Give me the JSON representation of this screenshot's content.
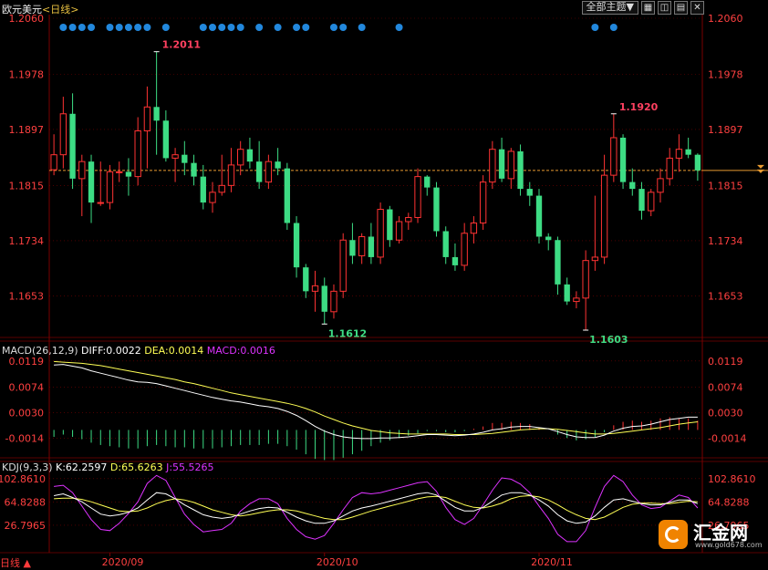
{
  "header": {
    "symbol": "欧元美元",
    "period": "<日线>",
    "theme_button": "全部主题▼",
    "window_icons": [
      "grid-icon",
      "layout-icon",
      "chart-icon",
      "close-icon"
    ]
  },
  "colors": {
    "up": "#ff3333",
    "down": "#3ddc84",
    "price_label": "#ff4040",
    "grid": "#7a0000",
    "dif": "#ffffff",
    "dea": "#ffff55",
    "macd": "#dd33ff",
    "k": "#ffffff",
    "d": "#ffff55",
    "j": "#dd33ff",
    "dots": "#2288dd"
  },
  "chart_data": [
    {
      "type": "candlestick",
      "title": "欧元美元<日线>",
      "y_ticks": [
        "1.2060",
        "1.1978",
        "1.1897",
        "1.1815",
        "1.1734",
        "1.1653"
      ],
      "y_tick_values": [
        1.206,
        1.1978,
        1.1897,
        1.1815,
        1.1734,
        1.1653
      ],
      "ylim": [
        1.1595,
        1.206
      ],
      "x_ticks": [
        "2020/09",
        "2020/10",
        "2020/11"
      ],
      "current_price": 1.1837,
      "annotations": [
        {
          "label": "1.2011",
          "kind": "high",
          "index": 11
        },
        {
          "label": "1.1612",
          "kind": "low",
          "index": 29
        },
        {
          "label": "1.1920",
          "kind": "high",
          "index": 60
        },
        {
          "label": "1.1603",
          "kind": "low",
          "index": 57
        }
      ],
      "signal_dot_indices": [
        1,
        2,
        3,
        4,
        6,
        7,
        8,
        9,
        10,
        12,
        16,
        17,
        18,
        19,
        20,
        22,
        24,
        26,
        27,
        30,
        31,
        33,
        37,
        58,
        60
      ],
      "candles": [
        {
          "o": 1.1838,
          "h": 1.189,
          "l": 1.183,
          "c": 1.186
        },
        {
          "o": 1.186,
          "h": 1.1945,
          "l": 1.184,
          "c": 1.192
        },
        {
          "o": 1.192,
          "h": 1.195,
          "l": 1.181,
          "c": 1.1825
        },
        {
          "o": 1.1825,
          "h": 1.186,
          "l": 1.177,
          "c": 1.185
        },
        {
          "o": 1.185,
          "h": 1.186,
          "l": 1.176,
          "c": 1.179
        },
        {
          "o": 1.179,
          "h": 1.185,
          "l": 1.1785,
          "c": 1.179
        },
        {
          "o": 1.179,
          "h": 1.1845,
          "l": 1.178,
          "c": 1.1835
        },
        {
          "o": 1.1835,
          "h": 1.185,
          "l": 1.182,
          "c": 1.1835
        },
        {
          "o": 1.1835,
          "h": 1.1855,
          "l": 1.18,
          "c": 1.1828
        },
        {
          "o": 1.1828,
          "h": 1.1915,
          "l": 1.1815,
          "c": 1.1895
        },
        {
          "o": 1.1895,
          "h": 1.196,
          "l": 1.184,
          "c": 1.193
        },
        {
          "o": 1.193,
          "h": 1.2011,
          "l": 1.186,
          "c": 1.191
        },
        {
          "o": 1.191,
          "h": 1.1925,
          "l": 1.185,
          "c": 1.1855
        },
        {
          "o": 1.1855,
          "h": 1.187,
          "l": 1.182,
          "c": 1.186
        },
        {
          "o": 1.186,
          "h": 1.188,
          "l": 1.183,
          "c": 1.1848
        },
        {
          "o": 1.1848,
          "h": 1.186,
          "l": 1.1815,
          "c": 1.1828
        },
        {
          "o": 1.1828,
          "h": 1.1845,
          "l": 1.178,
          "c": 1.179
        },
        {
          "o": 1.179,
          "h": 1.182,
          "l": 1.1775,
          "c": 1.1805
        },
        {
          "o": 1.1805,
          "h": 1.186,
          "l": 1.18,
          "c": 1.1815
        },
        {
          "o": 1.1815,
          "h": 1.187,
          "l": 1.1805,
          "c": 1.1845
        },
        {
          "o": 1.1845,
          "h": 1.188,
          "l": 1.183,
          "c": 1.1868
        },
        {
          "o": 1.1868,
          "h": 1.1885,
          "l": 1.184,
          "c": 1.185
        },
        {
          "o": 1.185,
          "h": 1.188,
          "l": 1.181,
          "c": 1.182
        },
        {
          "o": 1.182,
          "h": 1.186,
          "l": 1.181,
          "c": 1.185
        },
        {
          "o": 1.185,
          "h": 1.187,
          "l": 1.183,
          "c": 1.184
        },
        {
          "o": 1.184,
          "h": 1.1848,
          "l": 1.175,
          "c": 1.176
        },
        {
          "o": 1.176,
          "h": 1.177,
          "l": 1.168,
          "c": 1.1695
        },
        {
          "o": 1.1695,
          "h": 1.17,
          "l": 1.165,
          "c": 1.166
        },
        {
          "o": 1.166,
          "h": 1.169,
          "l": 1.163,
          "c": 1.1668
        },
        {
          "o": 1.1668,
          "h": 1.168,
          "l": 1.1612,
          "c": 1.163
        },
        {
          "o": 1.163,
          "h": 1.167,
          "l": 1.162,
          "c": 1.166
        },
        {
          "o": 1.166,
          "h": 1.1745,
          "l": 1.165,
          "c": 1.1735
        },
        {
          "o": 1.1735,
          "h": 1.176,
          "l": 1.17,
          "c": 1.1712
        },
        {
          "o": 1.1712,
          "h": 1.1745,
          "l": 1.17,
          "c": 1.174
        },
        {
          "o": 1.174,
          "h": 1.176,
          "l": 1.17,
          "c": 1.171
        },
        {
          "o": 1.171,
          "h": 1.179,
          "l": 1.17,
          "c": 1.178
        },
        {
          "o": 1.178,
          "h": 1.1785,
          "l": 1.1725,
          "c": 1.1735
        },
        {
          "o": 1.1735,
          "h": 1.177,
          "l": 1.173,
          "c": 1.1762
        },
        {
          "o": 1.1762,
          "h": 1.1775,
          "l": 1.175,
          "c": 1.1768
        },
        {
          "o": 1.1768,
          "h": 1.184,
          "l": 1.176,
          "c": 1.1828
        },
        {
          "o": 1.1828,
          "h": 1.183,
          "l": 1.18,
          "c": 1.1812
        },
        {
          "o": 1.1812,
          "h": 1.182,
          "l": 1.174,
          "c": 1.1748
        },
        {
          "o": 1.1748,
          "h": 1.1755,
          "l": 1.17,
          "c": 1.171
        },
        {
          "o": 1.171,
          "h": 1.173,
          "l": 1.169,
          "c": 1.1698
        },
        {
          "o": 1.1698,
          "h": 1.176,
          "l": 1.169,
          "c": 1.1745
        },
        {
          "o": 1.1745,
          "h": 1.177,
          "l": 1.173,
          "c": 1.176
        },
        {
          "o": 1.176,
          "h": 1.183,
          "l": 1.175,
          "c": 1.182
        },
        {
          "o": 1.182,
          "h": 1.188,
          "l": 1.181,
          "c": 1.1868
        },
        {
          "o": 1.1868,
          "h": 1.1885,
          "l": 1.182,
          "c": 1.1825
        },
        {
          "o": 1.1825,
          "h": 1.187,
          "l": 1.181,
          "c": 1.1865
        },
        {
          "o": 1.1865,
          "h": 1.1875,
          "l": 1.18,
          "c": 1.181
        },
        {
          "o": 1.181,
          "h": 1.182,
          "l": 1.1785,
          "c": 1.18
        },
        {
          "o": 1.18,
          "h": 1.181,
          "l": 1.173,
          "c": 1.174
        },
        {
          "o": 1.174,
          "h": 1.1745,
          "l": 1.172,
          "c": 1.1735
        },
        {
          "o": 1.1735,
          "h": 1.174,
          "l": 1.1655,
          "c": 1.167
        },
        {
          "o": 1.167,
          "h": 1.168,
          "l": 1.164,
          "c": 1.1645
        },
        {
          "o": 1.1645,
          "h": 1.166,
          "l": 1.1635,
          "c": 1.165
        },
        {
          "o": 1.165,
          "h": 1.172,
          "l": 1.1603,
          "c": 1.1705
        },
        {
          "o": 1.1705,
          "h": 1.18,
          "l": 1.169,
          "c": 1.171
        },
        {
          "o": 1.171,
          "h": 1.186,
          "l": 1.17,
          "c": 1.183
        },
        {
          "o": 1.183,
          "h": 1.192,
          "l": 1.182,
          "c": 1.1885
        },
        {
          "o": 1.1885,
          "h": 1.189,
          "l": 1.181,
          "c": 1.182
        },
        {
          "o": 1.182,
          "h": 1.184,
          "l": 1.18,
          "c": 1.181
        },
        {
          "o": 1.181,
          "h": 1.182,
          "l": 1.1765,
          "c": 1.1778
        },
        {
          "o": 1.1778,
          "h": 1.181,
          "l": 1.177,
          "c": 1.1805
        },
        {
          "o": 1.1805,
          "h": 1.184,
          "l": 1.179,
          "c": 1.1825
        },
        {
          "o": 1.1825,
          "h": 1.187,
          "l": 1.1815,
          "c": 1.1855
        },
        {
          "o": 1.1855,
          "h": 1.189,
          "l": 1.1835,
          "c": 1.1868
        },
        {
          "o": 1.1868,
          "h": 1.1885,
          "l": 1.1855,
          "c": 1.186
        },
        {
          "o": 1.186,
          "h": 1.1862,
          "l": 1.1822,
          "c": 1.1837
        }
      ]
    },
    {
      "type": "line",
      "title": "MACD(26,12,9)",
      "labels": {
        "dif": "DIFF:0.0022",
        "dea": "DEA:0.0014",
        "macd": "MACD:0.0016"
      },
      "y_ticks": [
        "0.0119",
        "0.0074",
        "0.0030",
        "-0.0014"
      ],
      "y_tick_values": [
        0.0119,
        0.0074,
        0.003,
        -0.0014
      ],
      "ylim": [
        -0.0045,
        0.0125
      ],
      "series": [
        {
          "key": "dif",
          "values": [
            0.0112,
            0.0113,
            0.011,
            0.0107,
            0.0102,
            0.0098,
            0.0094,
            0.009,
            0.0086,
            0.0083,
            0.0082,
            0.008,
            0.0076,
            0.0072,
            0.0068,
            0.0064,
            0.006,
            0.0056,
            0.0053,
            0.005,
            0.0048,
            0.0045,
            0.0042,
            0.004,
            0.0037,
            0.0032,
            0.0025,
            0.0016,
            0.0006,
            -0.0002,
            -0.0008,
            -0.0012,
            -0.0014,
            -0.0015,
            -0.0015,
            -0.0014,
            -0.0014,
            -0.0013,
            -0.0012,
            -0.001,
            -0.0008,
            -0.0008,
            -0.0009,
            -0.001,
            -0.0009,
            -0.0007,
            -0.0004,
            0.0,
            0.0002,
            0.0005,
            0.0006,
            0.0006,
            0.0004,
            0.0002,
            -0.0003,
            -0.0008,
            -0.0012,
            -0.0013,
            -0.0013,
            -0.0009,
            -0.0002,
            0.0003,
            0.0006,
            0.0007,
            0.001,
            0.0014,
            0.0018,
            0.002,
            0.0022,
            0.0022
          ]
        },
        {
          "key": "dea",
          "values": [
            0.0118,
            0.0117,
            0.0116,
            0.0115,
            0.0113,
            0.0111,
            0.0108,
            0.0105,
            0.0102,
            0.0099,
            0.0096,
            0.0093,
            0.009,
            0.0087,
            0.0083,
            0.008,
            0.0076,
            0.0072,
            0.0068,
            0.0064,
            0.0061,
            0.0058,
            0.0055,
            0.0052,
            0.0049,
            0.0046,
            0.0042,
            0.0037,
            0.0031,
            0.0024,
            0.0018,
            0.0012,
            0.0007,
            0.0003,
            -0.0001,
            -0.0003,
            -0.0005,
            -0.0006,
            -0.0007,
            -0.0007,
            -0.0007,
            -0.0007,
            -0.0007,
            -0.0008,
            -0.0008,
            -0.0008,
            -0.0007,
            -0.0006,
            -0.0004,
            -0.0002,
            0.0,
            0.0001,
            0.0002,
            0.0002,
            0.0001,
            -0.0001,
            -0.0003,
            -0.0005,
            -0.0007,
            -0.0007,
            -0.0006,
            -0.0004,
            -0.0002,
            0.0,
            0.0002,
            0.0004,
            0.0007,
            0.001,
            0.0012,
            0.0014
          ]
        },
        {
          "key": "macd",
          "values": [
            -0.0012,
            -0.0008,
            -0.0012,
            -0.0016,
            -0.0022,
            -0.0026,
            -0.0028,
            -0.003,
            -0.0032,
            -0.0032,
            -0.0028,
            -0.0026,
            -0.0028,
            -0.003,
            -0.003,
            -0.0032,
            -0.0032,
            -0.0032,
            -0.003,
            -0.0028,
            -0.0026,
            -0.0026,
            -0.0026,
            -0.0024,
            -0.0024,
            -0.0028,
            -0.0034,
            -0.0042,
            -0.005,
            -0.0052,
            -0.0052,
            -0.0048,
            -0.0042,
            -0.0036,
            -0.0028,
            -0.0022,
            -0.0018,
            -0.0014,
            -0.001,
            -0.0006,
            -0.0002,
            -0.0002,
            -0.0004,
            -0.0004,
            -0.0002,
            0.0002,
            0.0006,
            0.0012,
            0.0012,
            0.0014,
            0.0012,
            0.001,
            0.0004,
            0.0,
            -0.0008,
            -0.0014,
            -0.0018,
            -0.0016,
            -0.0012,
            -0.0004,
            0.0008,
            0.0014,
            0.0016,
            0.0014,
            0.0016,
            0.002,
            0.0022,
            0.002,
            0.002,
            0.0016
          ]
        }
      ]
    },
    {
      "type": "line",
      "title": "KDJ(9,3,3)",
      "labels": {
        "k": "K:62.2597",
        "d": "D:65.6263",
        "j": "J:55.5265"
      },
      "y_ticks": [
        "102.8610",
        "64.8288",
        "26.7965"
      ],
      "y_tick_values": [
        102.861,
        64.8288,
        26.7965
      ],
      "ylim": [
        -15,
        110
      ],
      "series": [
        {
          "key": "k",
          "values": [
            75,
            78,
            72,
            65,
            55,
            45,
            42,
            44,
            48,
            55,
            68,
            80,
            78,
            70,
            60,
            52,
            44,
            40,
            38,
            40,
            45,
            50,
            54,
            56,
            55,
            48,
            40,
            34,
            30,
            30,
            34,
            42,
            50,
            55,
            58,
            62,
            66,
            70,
            74,
            78,
            80,
            76,
            66,
            56,
            50,
            50,
            56,
            66,
            76,
            80,
            80,
            76,
            68,
            58,
            44,
            34,
            30,
            32,
            42,
            56,
            68,
            70,
            66,
            62,
            60,
            60,
            64,
            68,
            68,
            62
          ]
        },
        {
          "key": "d",
          "values": [
            70,
            71,
            71,
            69,
            65,
            60,
            55,
            50,
            49,
            50,
            55,
            62,
            67,
            70,
            68,
            64,
            58,
            52,
            48,
            44,
            42,
            44,
            47,
            50,
            52,
            52,
            50,
            46,
            42,
            38,
            36,
            36,
            40,
            45,
            50,
            54,
            58,
            62,
            66,
            70,
            73,
            74,
            72,
            66,
            60,
            56,
            55,
            58,
            63,
            70,
            74,
            75,
            73,
            68,
            60,
            51,
            44,
            38,
            36,
            40,
            48,
            56,
            61,
            63,
            63,
            62,
            62,
            64,
            66,
            65
          ]
        },
        {
          "key": "j",
          "values": [
            90,
            92,
            80,
            58,
            36,
            20,
            18,
            30,
            46,
            65,
            95,
            108,
            100,
            72,
            45,
            28,
            16,
            18,
            20,
            30,
            50,
            62,
            70,
            70,
            62,
            38,
            20,
            8,
            4,
            10,
            30,
            52,
            72,
            80,
            78,
            80,
            84,
            88,
            92,
            96,
            98,
            82,
            56,
            36,
            28,
            38,
            60,
            84,
            104,
            102,
            94,
            80,
            58,
            38,
            12,
            0,
            0,
            18,
            56,
            90,
            108,
            98,
            76,
            60,
            54,
            56,
            66,
            76,
            72,
            55
          ]
        }
      ]
    }
  ],
  "footer": {
    "period_selector": "日线 ▲",
    "brand": "汇金网",
    "brand_url": "www.gold678.com"
  }
}
